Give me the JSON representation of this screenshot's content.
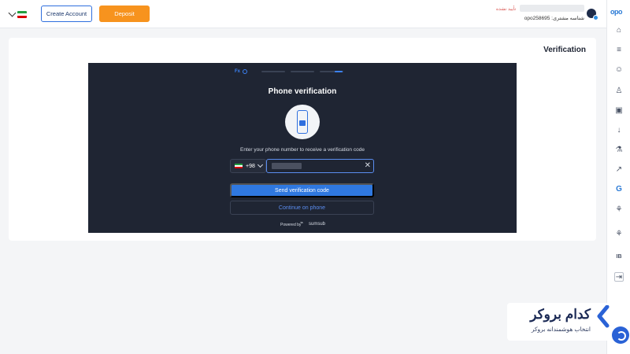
{
  "topbar": {
    "create_account": "Create Account",
    "deposit": "Deposit",
    "account_status": "تأیید نشده",
    "account_id": "شناسه مشتری: opo258695"
  },
  "sidebar": {
    "logo": "opo",
    "items": [
      "home-icon",
      "filter-icon",
      "users-icon",
      "user-icon",
      "wallet-icon",
      "download-icon",
      "flask-icon",
      "chart-icon",
      "brand-icon",
      "partners-icon",
      "network-icon",
      "ib-icon",
      "logout-icon"
    ],
    "ib_label": "IB",
    "brand_label": "G"
  },
  "main": {
    "title": "Verification"
  },
  "verification": {
    "brand": "Fx",
    "title": "Phone verification",
    "instruction": "Enter your phone number to receive a verification code",
    "country_code": "+98",
    "send_button": "Send verification code",
    "continue_button": "Continue on phone",
    "powered_by": "Powered by",
    "provider": "sumsub",
    "steps_total": 4,
    "step_current": 4
  },
  "watermark": {
    "title": "کدام بروکر",
    "subtitle": "انتخاب هوشمندانه بروکر"
  },
  "colors": {
    "accent": "#2f78e0",
    "deposit": "#f7931e",
    "panel_bg": "#1f2533"
  }
}
